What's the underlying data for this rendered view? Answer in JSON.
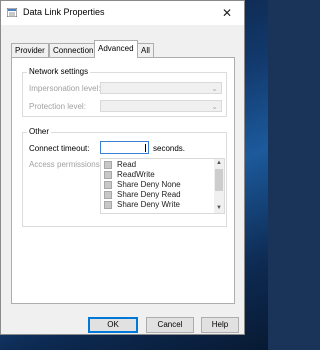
{
  "window": {
    "title": "Data Link Properties",
    "close_glyph": "✕"
  },
  "tabs": [
    {
      "label": "Provider"
    },
    {
      "label": "Connection"
    },
    {
      "label": "Advanced",
      "active": true
    },
    {
      "label": "All"
    }
  ],
  "network_settings": {
    "legend": "Network settings",
    "impersonation_label": "Impersonation level:",
    "impersonation_value": "",
    "protection_label": "Protection level:",
    "protection_value": ""
  },
  "other": {
    "legend": "Other",
    "timeout_label": "Connect timeout:",
    "timeout_value": "",
    "timeout_unit": "seconds.",
    "permissions_label": "Access permissions:",
    "permissions": [
      {
        "label": "Read",
        "checked": false
      },
      {
        "label": "ReadWrite",
        "checked": false
      },
      {
        "label": "Share Deny None",
        "checked": false
      },
      {
        "label": "Share Deny Read",
        "checked": false
      },
      {
        "label": "Share Deny Write",
        "checked": false
      }
    ]
  },
  "buttons": {
    "ok": "OK",
    "cancel": "Cancel",
    "help": "Help"
  },
  "colors": {
    "accent": "#0078d7",
    "dialog_bg": "#f0f0f0",
    "disabled_text": "#a0a0a0"
  }
}
